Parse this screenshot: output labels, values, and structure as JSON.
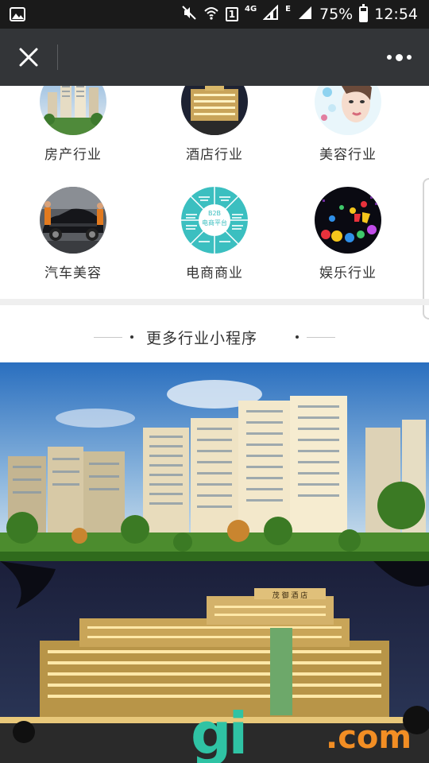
{
  "status_bar": {
    "network_type": "4G",
    "data_type": "E",
    "sim_slot": "1",
    "battery": "75%",
    "time": "12:54",
    "icons": [
      "image-icon",
      "mute-icon",
      "wifi-icon",
      "signal-icon",
      "battery-icon"
    ]
  },
  "nav": {
    "close_icon": "close-icon",
    "more_icon": "more-icon"
  },
  "industries": [
    {
      "label": "房产行业",
      "icon": "real-estate-thumbnail"
    },
    {
      "label": "酒店行业",
      "icon": "hotel-thumbnail"
    },
    {
      "label": "美容行业",
      "icon": "beauty-thumbnail"
    },
    {
      "label": "汽车美容",
      "icon": "car-care-thumbnail"
    },
    {
      "label": "电商商业",
      "icon": "ecommerce-thumbnail"
    },
    {
      "label": "娱乐行业",
      "icon": "entertainment-thumbnail"
    }
  ],
  "ecommerce_graphic": {
    "center_line1": "B2B",
    "center_line2": "电商平台"
  },
  "more_section": {
    "title": "更多行业小程序"
  },
  "banners": [
    {
      "name": "real-estate-banner"
    },
    {
      "name": "hotel-banner",
      "sign": "茂 御 酒 店"
    }
  ],
  "watermark": {
    "brand": "gi",
    "domain": ".com"
  },
  "colors": {
    "status_bar": "#1a1a1a",
    "nav_bar": "#333538",
    "ecommerce_teal": "#3bbfc0",
    "watermark_green": "#2fc3a4",
    "watermark_orange": "#f28e24"
  }
}
